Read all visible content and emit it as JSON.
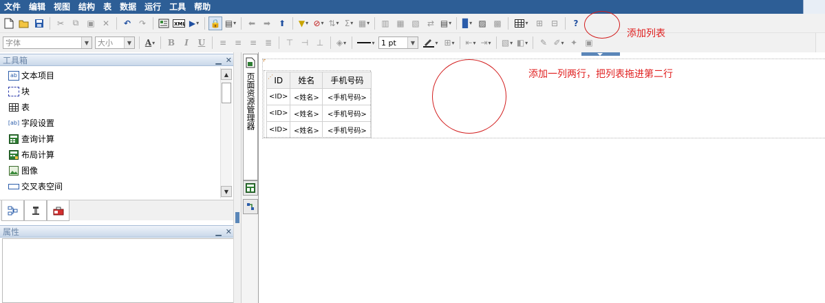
{
  "menu": [
    "文件",
    "编辑",
    "视图",
    "结构",
    "表",
    "数据",
    "运行",
    "工具",
    "帮助"
  ],
  "format_bar": {
    "font_placeholder": "字体",
    "size_placeholder": "大小",
    "bold": "B",
    "italic": "I",
    "underline": "U",
    "font_color_letter": "A",
    "line_width": "1 pt"
  },
  "toolbox": {
    "title": "工具箱",
    "items": [
      {
        "label": "文本项目",
        "icon": "text-item-icon"
      },
      {
        "label": "块",
        "icon": "block-icon"
      },
      {
        "label": "表",
        "icon": "table-icon"
      },
      {
        "label": "字段设置",
        "icon": "field-settings-icon"
      },
      {
        "label": "查询计算",
        "icon": "query-calculation-icon"
      },
      {
        "label": "布局计算",
        "icon": "layout-calculation-icon"
      },
      {
        "label": "图像",
        "icon": "image-icon"
      },
      {
        "label": "交叉表空间",
        "icon": "crosstab-space-icon"
      }
    ]
  },
  "properties": {
    "title": "属性"
  },
  "resource_tab": {
    "label": "页面资源管理器"
  },
  "list": {
    "headers": [
      "ID",
      "姓名",
      "手机号码"
    ],
    "rows": [
      [
        "<ID>",
        "<姓名>",
        "<手机号码>"
      ],
      [
        "<ID>",
        "<姓名>",
        "<手机号码>"
      ],
      [
        "<ID>",
        "<姓名>",
        "<手机号码>"
      ]
    ]
  },
  "annotations": {
    "add_list": "添加列表",
    "instruction": "添加一列两行，把列表拖进第二行",
    "color": "#e01f1f"
  },
  "colors": {
    "menubar": "#2d5e96",
    "toolbar": "#f1f1f1",
    "panel_header": "#c9d8ea"
  }
}
